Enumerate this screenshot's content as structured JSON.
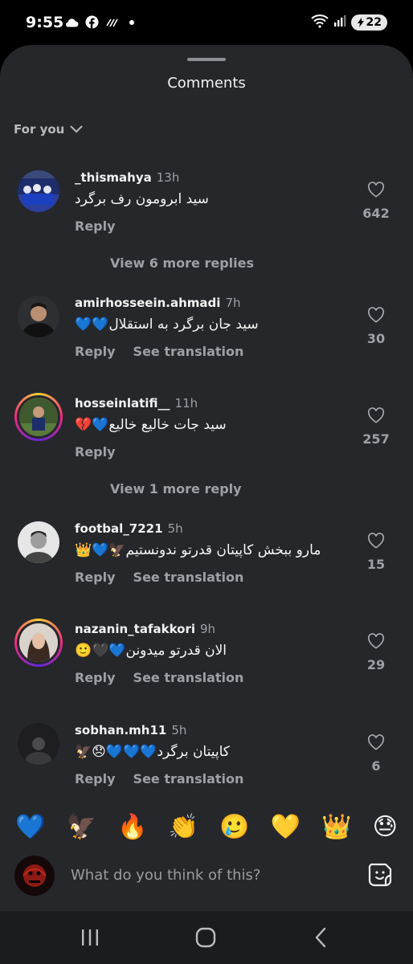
{
  "status_bar": {
    "time": "9:55",
    "battery": "22",
    "icons": [
      "cloud-icon",
      "facebook-icon",
      "sync-icon",
      "dot-icon",
      "wifi-icon",
      "signal-icon",
      "battery-icon"
    ]
  },
  "sheet": {
    "title": "Comments",
    "filter_label": "For you"
  },
  "comments": [
    {
      "username": "_thismahya",
      "time": "13h",
      "text": "سید ابرومون رف برگرد",
      "actions": [
        "Reply"
      ],
      "likes": "642",
      "view_replies": "View 6 more replies"
    },
    {
      "username": "amirhosseein.ahmadi",
      "time": "7h",
      "text": "سید جان برگرد به استقلال💙💙",
      "actions": [
        "Reply",
        "See translation"
      ],
      "likes": "30"
    },
    {
      "username": "hosseinlatifi__",
      "time": "11h",
      "text": "سید جات خالیع خالیع💙💔",
      "actions": [
        "Reply"
      ],
      "likes": "257",
      "view_replies": "View 1 more reply"
    },
    {
      "username": "footbal_7221",
      "time": "5h",
      "text": "مارو ببخش کاپیتان قدرتو ندونستیم🦅💙👑",
      "actions": [
        "Reply",
        "See translation"
      ],
      "likes": "15"
    },
    {
      "username": "nazanin_tafakkori",
      "time": "9h",
      "text": "الان قدرتو میدونن💙🖤🙂",
      "actions": [
        "Reply",
        "See translation"
      ],
      "likes": "29"
    },
    {
      "username": "sobhan.mh11",
      "time": "5h",
      "text": "کاپیتان برگرد💙💙💙😞🦅",
      "actions": [
        "Reply",
        "See translation"
      ],
      "likes": "6"
    }
  ],
  "emoji_bar": [
    "💙",
    "🦅",
    "🔥",
    "👏",
    "🥲",
    "💛",
    "👑",
    "😓"
  ],
  "composer": {
    "placeholder": "What do you think of this?"
  },
  "colors": {
    "sheet_background": "#25272b",
    "muted_text": "#9da0a5",
    "status_bar": "#000000",
    "nav_bar": "#1b1c1f"
  }
}
